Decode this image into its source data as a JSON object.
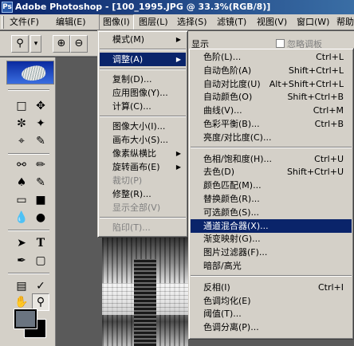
{
  "window": {
    "title": "Adobe Photoshop - [100_1995.JPG @ 33.3%(RGB/8)]",
    "app_icon": "Ps"
  },
  "menubar": {
    "items": [
      "文件(F)",
      "编辑(E)",
      "图像(I)",
      "图层(L)",
      "选择(S)",
      "滤镜(T)",
      "视图(V)",
      "窗口(W)",
      "帮助(H)"
    ],
    "active": "图像(I)"
  },
  "options_bar": {
    "tool_icon": "magnifier-icon",
    "dropdown_arrow": "▾",
    "zoom_in": "⊕",
    "zoom_out": "⊖",
    "partial_label": "显示",
    "checkbox_label": "忽略调板"
  },
  "toolbox": {
    "foreground_color": "#6a7480",
    "background_color": "#000000"
  },
  "image_menu": {
    "items": [
      {
        "label": "模式(M)",
        "submenu": true
      },
      {
        "separator": true
      },
      {
        "label": "调整(A)",
        "submenu": true,
        "highlighted": true
      },
      {
        "separator": true
      },
      {
        "label": "复制(D)..."
      },
      {
        "label": "应用图像(Y)..."
      },
      {
        "label": "计算(C)..."
      },
      {
        "separator": true
      },
      {
        "label": "图像大小(I)..."
      },
      {
        "label": "画布大小(S)..."
      },
      {
        "label": "像素纵横比",
        "submenu": true
      },
      {
        "label": "旋转画布(E)",
        "submenu": true
      },
      {
        "label": "裁切(P)",
        "disabled": true
      },
      {
        "label": "修整(R)..."
      },
      {
        "label": "显示全部(V)",
        "disabled": true
      },
      {
        "separator": true
      },
      {
        "label": "陷印(T)...",
        "disabled": true
      }
    ]
  },
  "adjust_menu": {
    "items": [
      {
        "label": "色阶(L)...",
        "shortcut": "Ctrl+L"
      },
      {
        "label": "自动色阶(A)",
        "shortcut": "Shift+Ctrl+L"
      },
      {
        "label": "自动对比度(U)",
        "shortcut": "Alt+Shift+Ctrl+L"
      },
      {
        "label": "自动颜色(O)",
        "shortcut": "Shift+Ctrl+B"
      },
      {
        "label": "曲线(V)...",
        "shortcut": "Ctrl+M"
      },
      {
        "label": "色彩平衡(B)...",
        "shortcut": "Ctrl+B"
      },
      {
        "label": "亮度/对比度(C)...",
        "shortcut": ""
      },
      {
        "separator": true
      },
      {
        "label": "色相/饱和度(H)...",
        "shortcut": "Ctrl+U"
      },
      {
        "label": "去色(D)",
        "shortcut": "Shift+Ctrl+U"
      },
      {
        "label": "颜色匹配(M)...",
        "shortcut": ""
      },
      {
        "label": "替换颜色(R)...",
        "shortcut": ""
      },
      {
        "label": "可选颜色(S)...",
        "shortcut": ""
      },
      {
        "label": "通道混合器(X)...",
        "shortcut": "",
        "highlighted": true
      },
      {
        "label": "渐变映射(G)...",
        "shortcut": ""
      },
      {
        "label": "图片过滤器(F)...",
        "shortcut": ""
      },
      {
        "label": "暗部/高光",
        "shortcut": ""
      },
      {
        "separator": true
      },
      {
        "label": "反相(I)",
        "shortcut": "Ctrl+I"
      },
      {
        "label": "色调均化(E)",
        "shortcut": ""
      },
      {
        "label": "阈值(T)...",
        "shortcut": ""
      },
      {
        "label": "色调分离(P)...",
        "shortcut": ""
      }
    ]
  }
}
